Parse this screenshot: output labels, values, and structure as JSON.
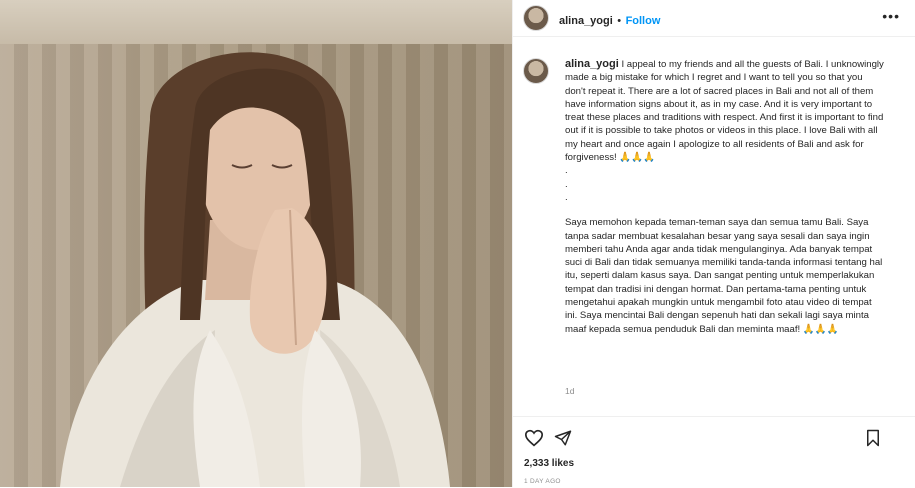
{
  "post": {
    "photo_alt": "woman with closed eyes and hands pressed together",
    "author": {
      "username": "alina_yogi",
      "separator": "•",
      "follow_label": "Follow"
    },
    "more_label": "•••",
    "caption": {
      "username": "alina_yogi",
      "english": "I appeal to my friends and all the guests of Bali. I unknowingly made a big mistake for which I regret and I want to tell you so that you don't repeat it. There are a lot of sacred places in Bali and not all of them have information signs about it, as in my case. And it is very important to treat these places and traditions with respect. And first it is important to find out if it is possible to take photos or videos in this place. I love Bali with all my heart and once again I apologize to all residents of Bali and ask for forgiveness! 🙏🙏🙏",
      "dots": [
        ".",
        ".",
        "."
      ],
      "indonesian": "Saya memohon kepada teman-teman saya dan semua tamu Bali. Saya tanpa sadar membuat kesalahan besar yang saya sesali dan saya ingin memberi tahu Anda agar anda tidak mengulanginya. Ada banyak tempat suci di Bali dan tidak semuanya memiliki tanda-tanda informasi tentang hal itu, seperti dalam kasus saya. Dan sangat penting untuk memperlakukan tempat dan tradisi ini dengan hormat. Dan pertama-tama penting untuk mengetahui apakah mungkin untuk mengambil foto atau video di tempat ini. Saya mencintai Bali dengan sepenuh hati dan sekali lagi saya minta maaf kepada semua penduduk Bali dan meminta maaf! 🙏🙏🙏",
      "time_ago": "1d"
    },
    "actions": {
      "like_icon": "heart-icon",
      "share_icon": "send-icon",
      "save_icon": "bookmark-icon"
    },
    "likes": "2,333 likes",
    "date": "1 DAY AGO"
  }
}
